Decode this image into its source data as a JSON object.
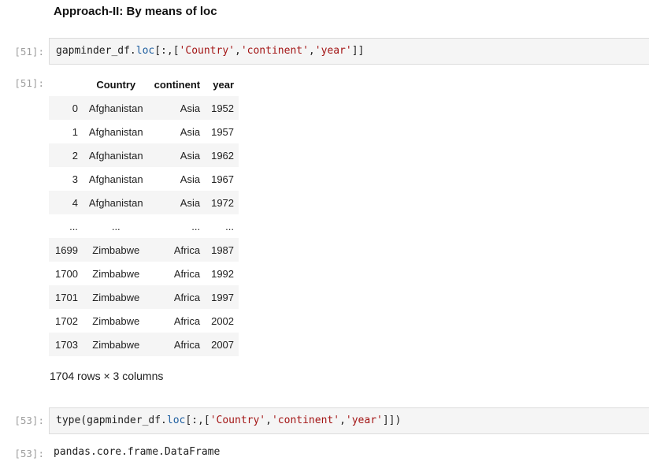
{
  "heading": "Approach-II: By means of loc",
  "cells": [
    {
      "in_prompt": "[51]:",
      "code": [
        {
          "t": "gapminder_df.",
          "c": ""
        },
        {
          "t": "loc",
          "c": "attr"
        },
        {
          "t": "[:,[",
          "c": ""
        },
        {
          "t": "'Country'",
          "c": "str"
        },
        {
          "t": ",",
          "c": ""
        },
        {
          "t": "'continent'",
          "c": "str"
        },
        {
          "t": ",",
          "c": ""
        },
        {
          "t": "'year'",
          "c": "str"
        },
        {
          "t": "]]",
          "c": ""
        }
      ],
      "out_prompt": "[51]:"
    },
    {
      "in_prompt": "[53]:",
      "code": [
        {
          "t": "type(gapminder_df.",
          "c": ""
        },
        {
          "t": "loc",
          "c": "attr"
        },
        {
          "t": "[:,[",
          "c": ""
        },
        {
          "t": "'Country'",
          "c": "str"
        },
        {
          "t": ",",
          "c": ""
        },
        {
          "t": "'continent'",
          "c": "str"
        },
        {
          "t": ",",
          "c": ""
        },
        {
          "t": "'year'",
          "c": "str"
        },
        {
          "t": "]])",
          "c": ""
        }
      ],
      "out_prompt": "[53]:",
      "output": "pandas.core.frame.DataFrame"
    }
  ],
  "dataframe": {
    "columns": [
      "",
      "Country",
      "continent",
      "year"
    ],
    "rows": [
      [
        "0",
        "Afghanistan",
        "Asia",
        "1952"
      ],
      [
        "1",
        "Afghanistan",
        "Asia",
        "1957"
      ],
      [
        "2",
        "Afghanistan",
        "Asia",
        "1962"
      ],
      [
        "3",
        "Afghanistan",
        "Asia",
        "1967"
      ],
      [
        "4",
        "Afghanistan",
        "Asia",
        "1972"
      ],
      [
        "...",
        "...",
        "...",
        "..."
      ],
      [
        "1699",
        "Zimbabwe",
        "Africa",
        "1987"
      ],
      [
        "1700",
        "Zimbabwe",
        "Africa",
        "1992"
      ],
      [
        "1701",
        "Zimbabwe",
        "Africa",
        "1997"
      ],
      [
        "1702",
        "Zimbabwe",
        "Africa",
        "2002"
      ],
      [
        "1703",
        "Zimbabwe",
        "Africa",
        "2007"
      ]
    ],
    "shape_text": "1704 rows × 3 columns"
  }
}
